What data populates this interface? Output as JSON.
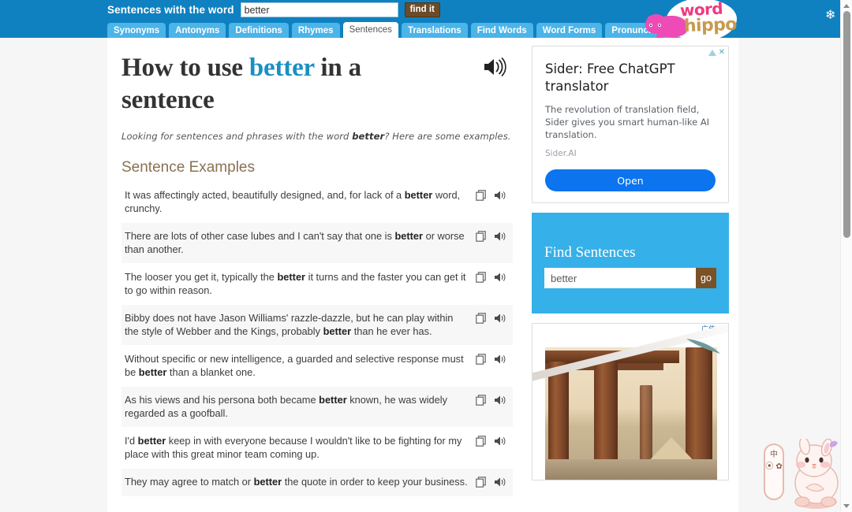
{
  "topbar": {
    "search_label": "Sentences with the word",
    "search_value": "better",
    "search_placeholder": "",
    "find_button": "find it",
    "snowflake_icon": "snowflake-icon"
  },
  "tabs": [
    {
      "label": "Synonyms",
      "active": false
    },
    {
      "label": "Antonyms",
      "active": false
    },
    {
      "label": "Definitions",
      "active": false
    },
    {
      "label": "Rhymes",
      "active": false
    },
    {
      "label": "Sentences",
      "active": true
    },
    {
      "label": "Translations",
      "active": false
    },
    {
      "label": "Find Words",
      "active": false
    },
    {
      "label": "Word Forms",
      "active": false
    },
    {
      "label": "Pronunciations",
      "active": false
    }
  ],
  "logo": {
    "word": "word",
    "hippo": "hippo",
    "word_color": "#ee3a7f",
    "hippo_color": "#c89a4e",
    "mascot_color": "#ef4bb6"
  },
  "main": {
    "title_prefix": "How to use ",
    "title_word": "better",
    "title_suffix": " in a sentence",
    "title_speaker_icon": "speaker-icon",
    "subtitle_before": "Looking for sentences and phrases with the word ",
    "subtitle_word": "better",
    "subtitle_after": "? Here are some examples.",
    "section_title": "Sentence Examples",
    "copy_icon": "copy-icon",
    "speaker_icon": "speaker-icon"
  },
  "sentences": [
    {
      "before": "It was affectingly acted, beautifully designed, and, for lack of a ",
      "word": "better",
      "after": " word, crunchy."
    },
    {
      "before": "There are lots of other case lubes and I can't say that one is ",
      "word": "better",
      "after": " or worse than another."
    },
    {
      "before": "The looser you get it, typically the ",
      "word": "better",
      "after": " it turns and the faster you can get it to go within reason."
    },
    {
      "before": "Bibby does not have Jason Williams' razzle-dazzle, but he can play within the style of Webber and the Kings, probably ",
      "word": "better",
      "after": " than he ever has."
    },
    {
      "before": "Without specific or new intelligence, a guarded and selective response must be ",
      "word": "better",
      "after": " than a blanket one."
    },
    {
      "before": "As his views and his persona both became ",
      "word": "better",
      "after": " known, he was widely regarded as a goofball."
    },
    {
      "before": "I'd ",
      "word": "better",
      "after": " keep in with everyone because I wouldn't like to be fighting for my place with this great minor team coming up."
    },
    {
      "before": "They may agree to match or ",
      "word": "better",
      "after": " the quote in order to keep your business."
    }
  ],
  "ad_top": {
    "adchoices_icon": "adchoices-icon",
    "close_icon": "close-icon",
    "title": "Sider: Free ChatGPT translator",
    "description": "The revolution of translation field, Sider gives you smart human-like AI translation.",
    "brand": "Sider.AI",
    "cta": "Open",
    "cta_color": "#0b74ee"
  },
  "find_sentences": {
    "heading": "Find Sentences",
    "input_value": "better",
    "input_placeholder": "",
    "go_button": "go",
    "panel_color": "#36b0e8",
    "go_color": "#7a5227"
  },
  "ad_bottom": {
    "label": "广告",
    "close_icon": "close-icon",
    "image_alt": "ancient-stone-pillars-photo"
  },
  "sticker": {
    "name": "kawaii-bunny-sticker",
    "button_chars": "中 ⦿ ✿",
    "button_name": "chinese-ime-indicator"
  },
  "scrollbar": {
    "up_arrow_icon": "scroll-up-arrow-icon",
    "down_arrow_icon": "scroll-down-arrow-icon",
    "thumb_name": "scrollbar-thumb"
  }
}
